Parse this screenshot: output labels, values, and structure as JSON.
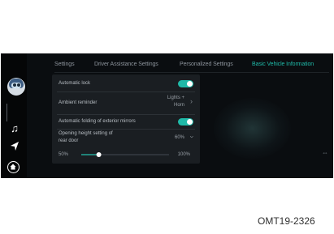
{
  "tabs": [
    {
      "label": "Settings",
      "active": false
    },
    {
      "label": "Driver Assistance Settings",
      "active": false
    },
    {
      "label": "Personalized Settings",
      "active": false
    },
    {
      "label": "Basic Vehicle Information",
      "active": true
    }
  ],
  "rows": {
    "auto_lock": {
      "label": "Automatic lock",
      "on": true
    },
    "ambient": {
      "label": "Ambient reminder",
      "value_line1": "Lights +",
      "value_line2": "Horn"
    },
    "mirrors": {
      "label": "Automatic folding of exterior mirrors",
      "on": true
    },
    "rear_door": {
      "label_line1": "Opening height setting of",
      "label_line2": "rear door",
      "value": "60%"
    }
  },
  "slider": {
    "min_label": "50%",
    "max_label": "100%",
    "value_percent": 60
  },
  "caption": "OMT19-2326",
  "colors": {
    "accent": "#1fb9a8",
    "panel": "#1a1e22",
    "screen": "#0a0d10"
  },
  "icons": [
    "assistant-avatar-icon",
    "music-note-icon",
    "navigation-arrow-icon",
    "home-icon"
  ]
}
